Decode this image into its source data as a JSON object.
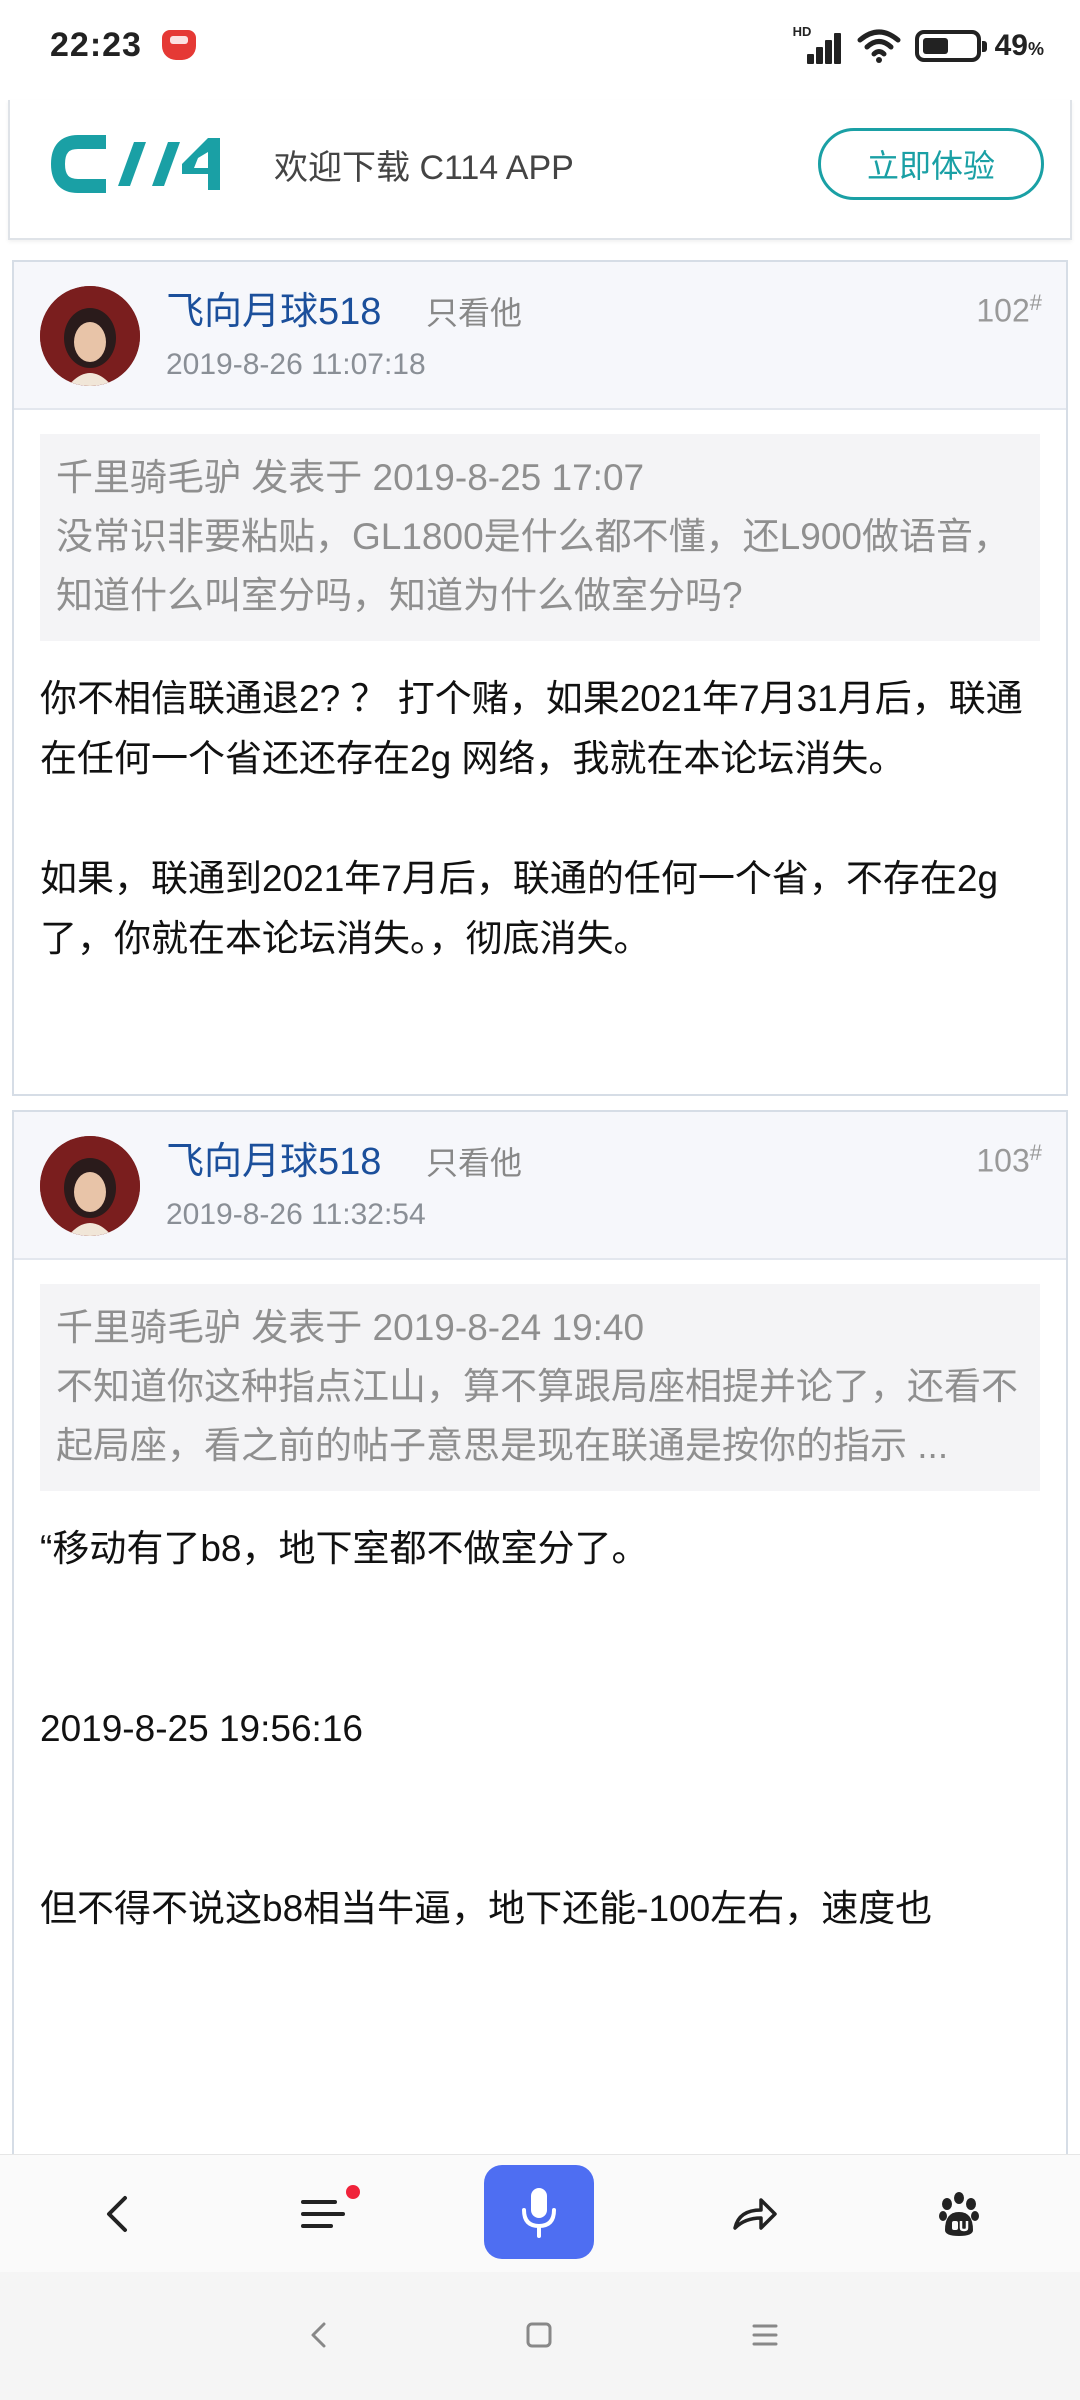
{
  "status_bar": {
    "time": "22:23",
    "network_label": "HD",
    "battery_percent": "49",
    "battery_unit": "%",
    "battery_level": 0.49
  },
  "banner": {
    "logo_text": "C114",
    "text": "欢迎下载 C114 APP",
    "button_label": "立即体验",
    "accent_color": "#1aa0a5"
  },
  "posts": [
    {
      "username": "飞向月球518",
      "only_him": "只看他",
      "date": "2019-8-26 11:07:18",
      "floor": "102",
      "floor_mark": "#",
      "quote_header": "千里骑毛驴 发表于 2019-8-25 17:07",
      "quote_body": "没常识非要粘贴，GL1800是什么都不懂，还L900做语音，知道什么叫室分吗，知道为什么做室分吗?",
      "para1": "你不相信联通退2? ？ 打个赌，如果2021年7月31月后，联通在任何一个省还还存在2g 网络，我就在本论坛消失。",
      "para2": "如果，联通到2021年7月后，联通的任何一个省，不存在2g了，你就在本论坛消失。，彻底消失。"
    },
    {
      "username": "飞向月球518",
      "only_him": "只看他",
      "date": "2019-8-26 11:32:54",
      "floor": "103",
      "floor_mark": "#",
      "quote_header": "千里骑毛驴 发表于 2019-8-24 19:40",
      "quote_body": "不知道你这种指点江山，算不算跟局座相提并论了，还看不起局座，看之前的帖子意思是现在联通是按你的指示 ...",
      "para1": "“移动有了b8，地下室都不做室分了。",
      "para2": "2019-8-25 19:56:16",
      "para3": "但不得不说这b8相当牛逼，地下还能-100左右，速度也"
    }
  ],
  "bottom_nav": {
    "items": [
      "back-icon",
      "menu-icon",
      "microphone-icon",
      "share-icon",
      "baidu-paw-icon"
    ],
    "mic_color": "#4e6ef2",
    "badge_color": "#f0233a"
  },
  "system_nav": {
    "items": [
      "back-icon",
      "home-icon",
      "recents-icon"
    ]
  }
}
